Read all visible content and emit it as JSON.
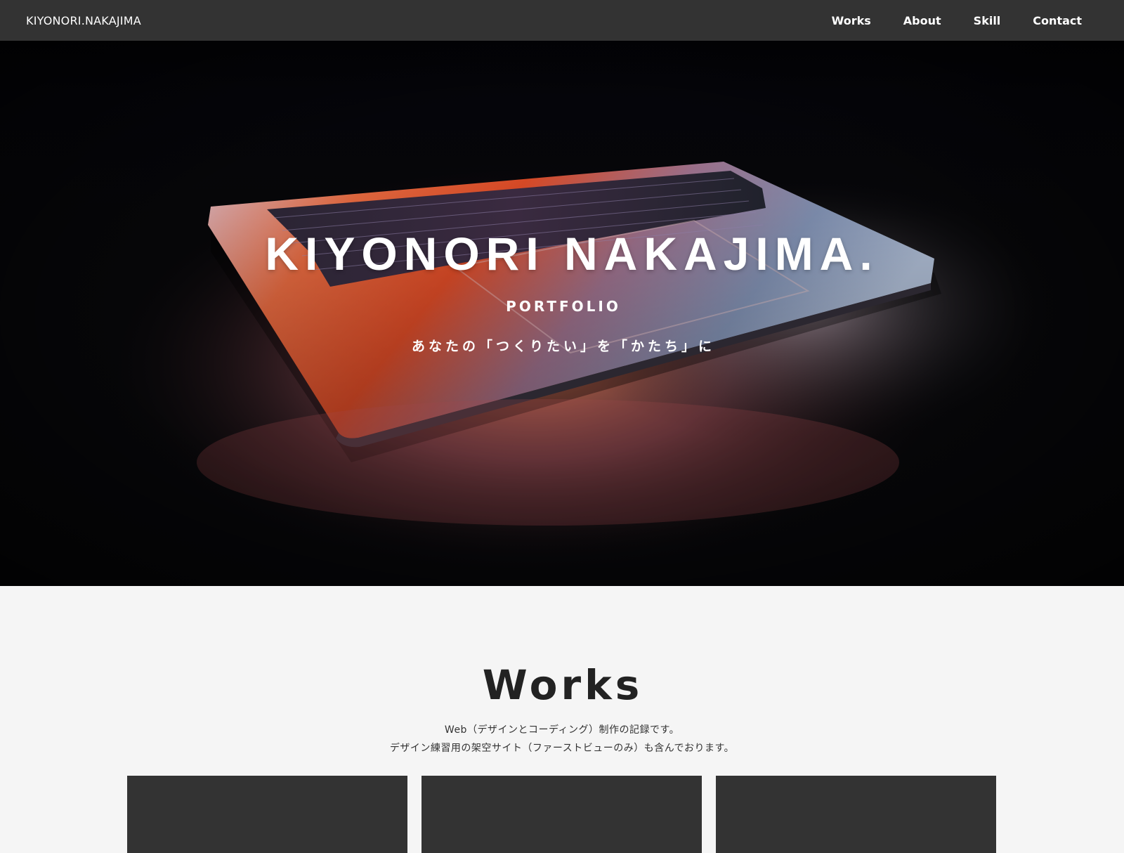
{
  "header": {
    "logo": "KIYONORI.NAKAJIMA",
    "nav": [
      "Works",
      "About",
      "Skill",
      "Contact"
    ]
  },
  "hero": {
    "title": "KIYONORI NAKAJIMA.",
    "subtitle": "PORTFOLIO",
    "tagline": "あなたの「つくりたい」を「かたち」に",
    "image": "laptop-keyboard-glow-photo"
  },
  "works": {
    "title": "Works",
    "description": [
      "Web（デザインとコーディング）制作の記録です。",
      "デザイン練習用の架空サイト（ファーストビューのみ）も含んでおります。"
    ],
    "card_count": 3
  },
  "colors": {
    "header_bg": "#333333",
    "page_bg": "#f5f5f5",
    "card_bg": "#333333",
    "text_dark": "#222222"
  }
}
